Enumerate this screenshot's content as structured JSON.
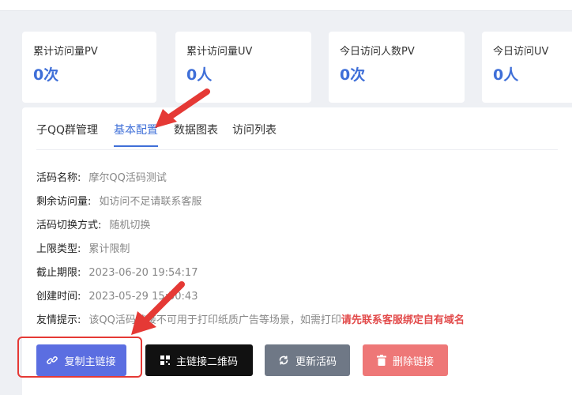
{
  "stats": [
    {
      "label": "累计访问量PV",
      "value": "0次"
    },
    {
      "label": "累计访问量UV",
      "value": "0人"
    },
    {
      "label": "今日访问人数PV",
      "value": "0次"
    },
    {
      "label": "今日访问UV",
      "value": "0人"
    }
  ],
  "tabs": [
    {
      "label": "子QQ群管理"
    },
    {
      "label": "基本配置",
      "active": true
    },
    {
      "label": "数据图表"
    },
    {
      "label": "访问列表"
    }
  ],
  "details": [
    {
      "key": "活码名称:",
      "value": "摩尔QQ活码测试"
    },
    {
      "key": "剩余访问量:",
      "value": "如访问不足请联系客服"
    },
    {
      "key": "活码切换方式:",
      "value": "随机切换"
    },
    {
      "key": "上限类型:",
      "value": "累计限制"
    },
    {
      "key": "截止期限:",
      "value": "2023-06-20 19:54:17"
    },
    {
      "key": "创建时间:",
      "value": "2023-05-29 15:50:43"
    }
  ],
  "tip": {
    "key": "友情提示:",
    "text": "该QQ活码链接不可用于打印纸质广告等场景，如需打印",
    "highlight": "请先联系客服绑定自有域名"
  },
  "buttons": {
    "copy": "复制主链接",
    "qrcode": "主链接二维码",
    "update": "更新活码",
    "delete": "删除链接"
  },
  "colors": {
    "accent": "#3f6fd8",
    "copy_btn": "#5b6ee1",
    "qr_btn": "#111111",
    "update_btn": "#6f7886",
    "delete_btn": "#ee7777",
    "annotation": "#e53935"
  },
  "icons": {
    "copy": "link-icon",
    "qrcode": "qrcode-icon",
    "update": "refresh-icon",
    "delete": "trash-icon"
  }
}
